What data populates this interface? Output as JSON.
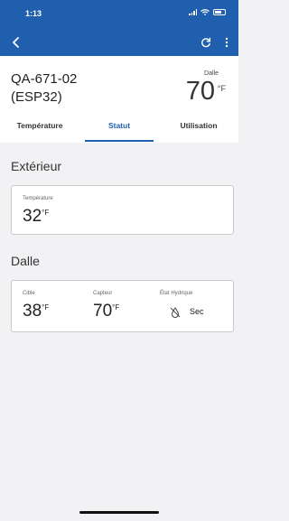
{
  "status_bar": {
    "time": "1:13"
  },
  "device": {
    "name_line1": "QA-671-02",
    "name_line2": "(ESP32)"
  },
  "slab_summary": {
    "label": "Dalle",
    "value": "70",
    "unit": "°F"
  },
  "tabs": [
    {
      "label": "Température",
      "active": false
    },
    {
      "label": "Statut",
      "active": true
    },
    {
      "label": "Utilisation",
      "active": false
    }
  ],
  "exterior": {
    "title": "Extérieur",
    "temperature_label": "Température",
    "temperature_value": "32",
    "temperature_unit": "°F"
  },
  "slab": {
    "title": "Dalle",
    "target_label": "Cible",
    "target_value": "38",
    "target_unit": "°F",
    "sensor_label": "Capteur",
    "sensor_value": "70",
    "sensor_unit": "°F",
    "hydric_label": "État Hydrique",
    "hydric_value": "Sec",
    "hydric_icon": "water-drop-off-icon"
  },
  "colors": {
    "primary": "#1f5fae",
    "background": "#f2f2f4"
  }
}
